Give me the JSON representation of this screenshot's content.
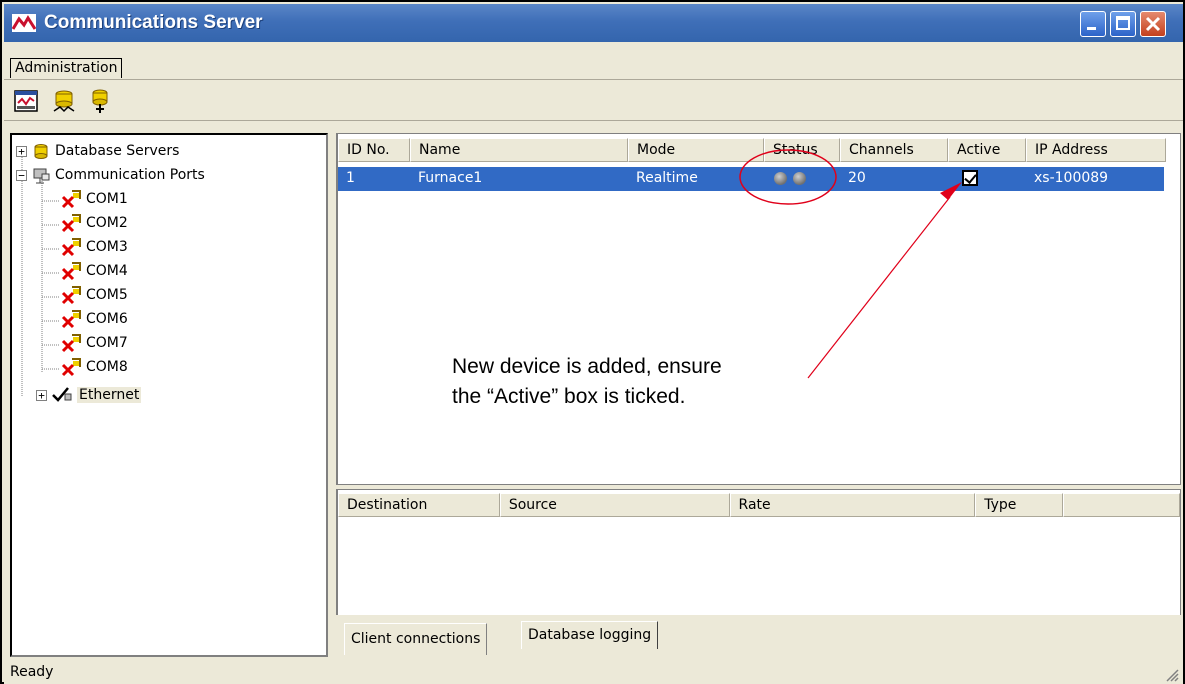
{
  "window": {
    "title": "Communications Server",
    "accent_color": "#3f6fb8"
  },
  "menubar": {
    "items": [
      {
        "label": "Administration"
      }
    ]
  },
  "toolbar": {
    "buttons": [
      {
        "icon": "server-monitor-icon"
      },
      {
        "icon": "connect-database-icon"
      },
      {
        "icon": "add-device-icon"
      }
    ]
  },
  "tree": {
    "database_servers": "Database Servers",
    "communication_ports": "Communication Ports",
    "ports": [
      "COM1",
      "COM2",
      "COM3",
      "COM4",
      "COM5",
      "COM6",
      "COM7",
      "COM8"
    ],
    "ethernet": "Ethernet"
  },
  "devices": {
    "columns": [
      "ID No.",
      "Name",
      "Mode",
      "Status",
      "Channels",
      "Active",
      "IP Address"
    ],
    "rows": [
      {
        "id": "1",
        "name": "Furnace1",
        "mode": "Realtime",
        "channels": "20",
        "active": true,
        "ip": "xs-100089"
      }
    ]
  },
  "connections": {
    "columns": [
      "Destination",
      "Source",
      "Rate",
      "Type"
    ]
  },
  "tabs": {
    "client_connections": "Client connections",
    "database_logging": "Database logging"
  },
  "statusbar": {
    "text": "Ready"
  },
  "annotation": {
    "line1": "New device is added, ensure",
    "line2": "the “Active” box is ticked.",
    "color": "#e0001a"
  }
}
